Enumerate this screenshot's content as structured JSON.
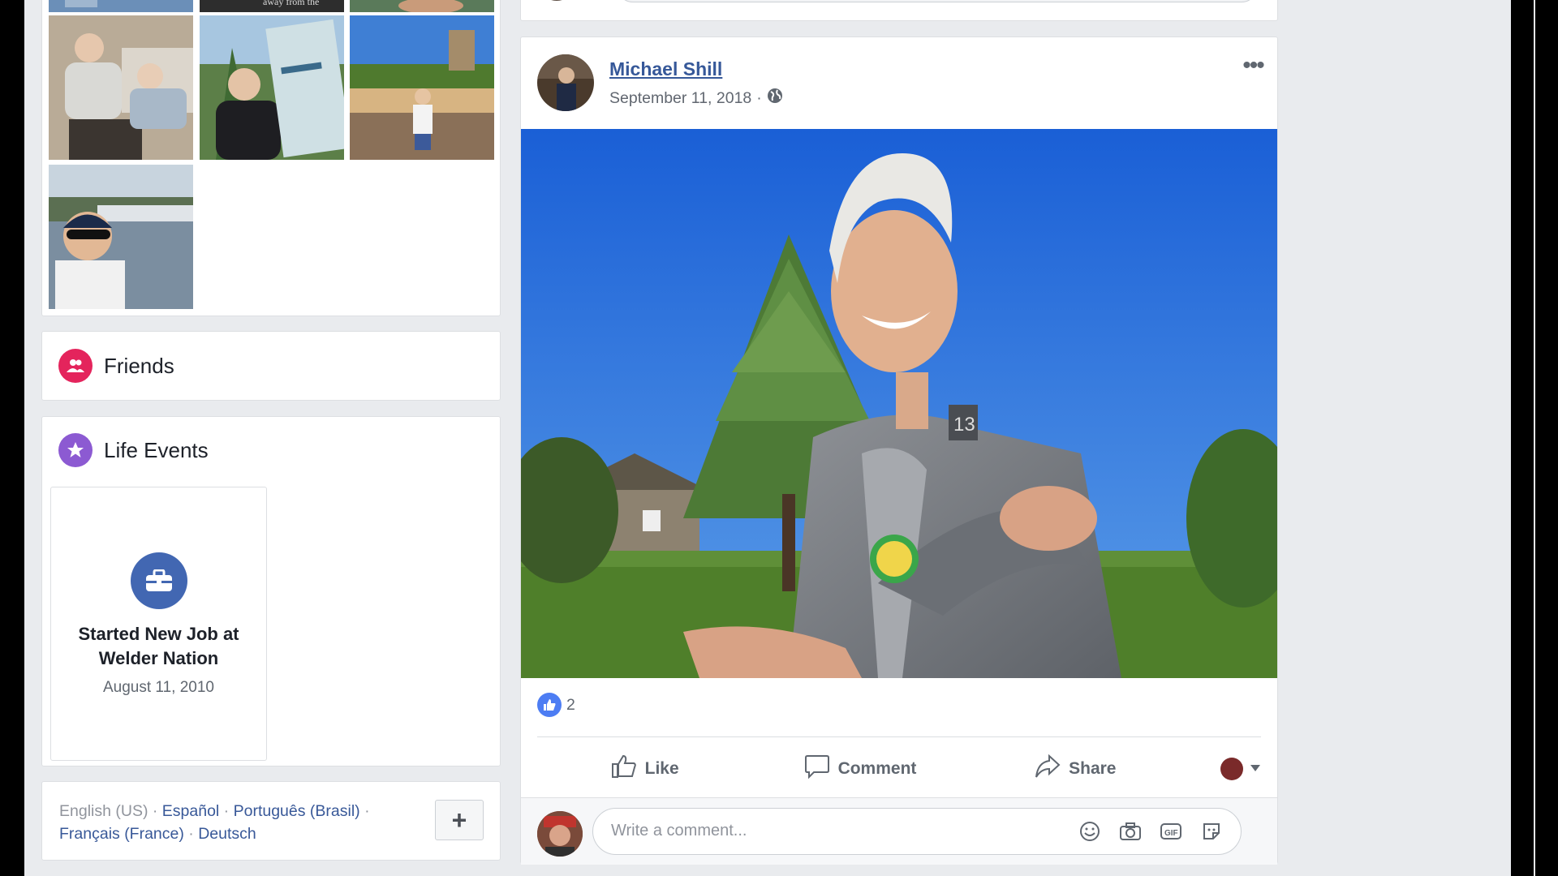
{
  "photos": {
    "thumb_caption_top": "away from the"
  },
  "friends": {
    "title": "Friends"
  },
  "life_events": {
    "title": "Life Events",
    "items": [
      {
        "title": "Started New Job at Welder Nation",
        "date": "August 11, 2010"
      }
    ]
  },
  "languages": {
    "current": "English (US)",
    "others": [
      "Español",
      "Português (Brasil)",
      "Français (France)",
      "Deutsch"
    ],
    "separator": " · ",
    "add_label": "+"
  },
  "post": {
    "author": "Michael Shill",
    "date": "September 11, 2018",
    "date_separator": "·",
    "reaction_count": "2",
    "actions": {
      "like": "Like",
      "comment": "Comment",
      "share": "Share"
    },
    "comment_placeholder": "Write a comment..."
  },
  "colors": {
    "link": "#385898",
    "author": "#365899",
    "friends_icon": "#e4245c",
    "events_icon": "#8c5ad2",
    "event_badge": "#4267b2",
    "like_badge": "#4d7df3"
  },
  "icons": {
    "friends": "friends-icon",
    "life_events": "star-icon",
    "event": "briefcase-icon",
    "privacy": "globe-icon",
    "more": "more-dots-icon",
    "like": "thumbs-up-icon",
    "comment": "comment-icon",
    "share": "share-icon",
    "emoji": "smiley-icon",
    "photo": "camera-icon",
    "gif": "gif-icon",
    "sticker": "sticker-icon"
  }
}
